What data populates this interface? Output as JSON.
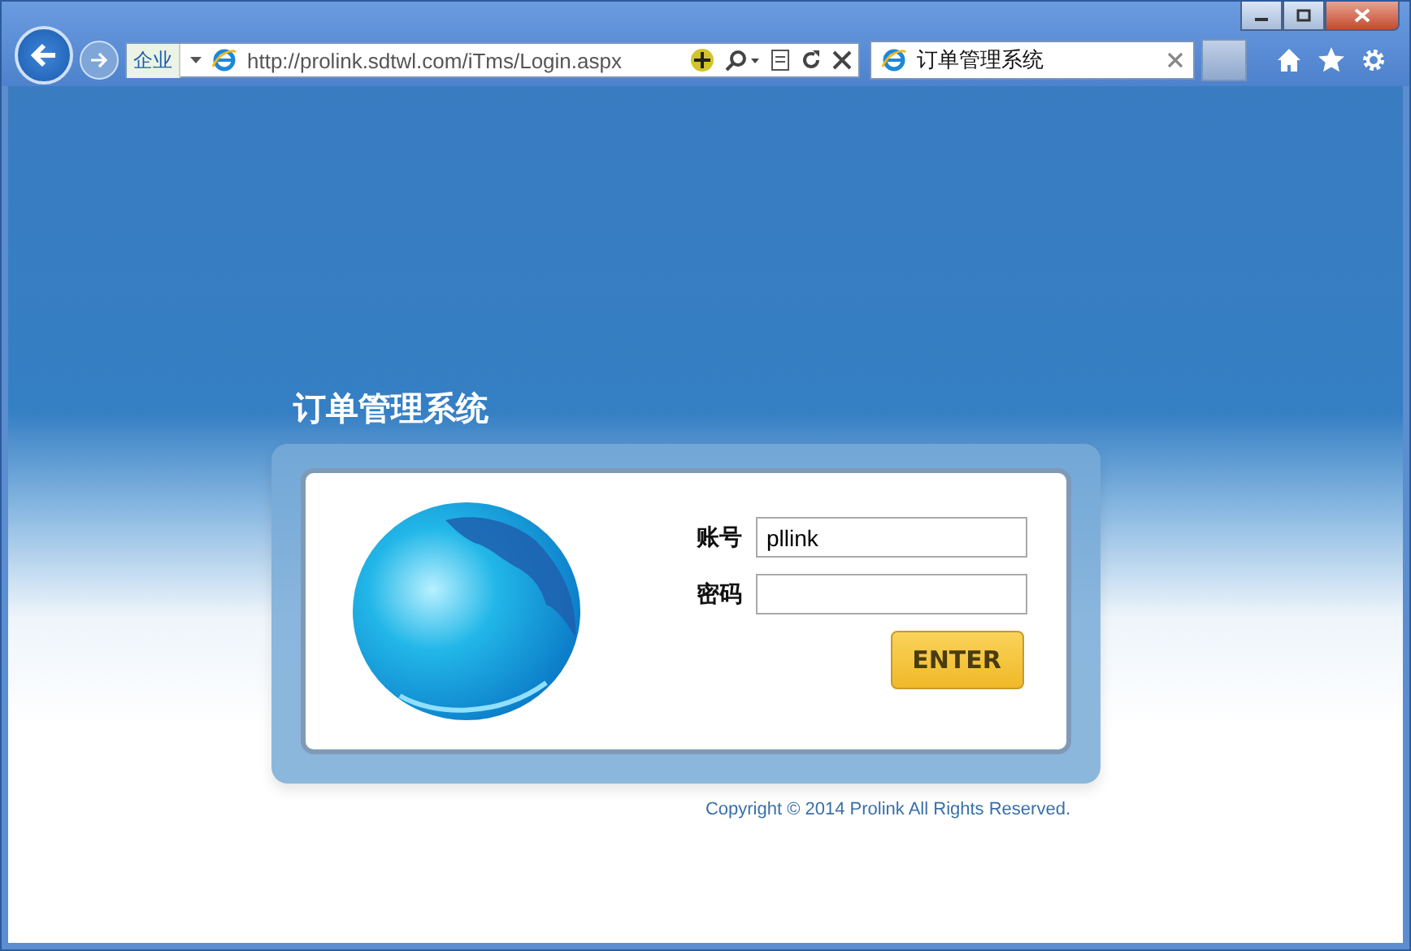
{
  "browser": {
    "address_zone": "企业",
    "address": "http://prolink.sdtwl.com/iTms/Login.aspx",
    "tabs": [
      {
        "title": "订单管理系统",
        "selected": true
      }
    ]
  },
  "page": {
    "title": "订单管理系统",
    "fields": [
      {
        "label": "账号",
        "value": "pllink"
      },
      {
        "label": "密码"
      }
    ],
    "enter_button": "ENTER",
    "copyright": "Copyright © 2014 Prolink All Rights Reserved."
  }
}
